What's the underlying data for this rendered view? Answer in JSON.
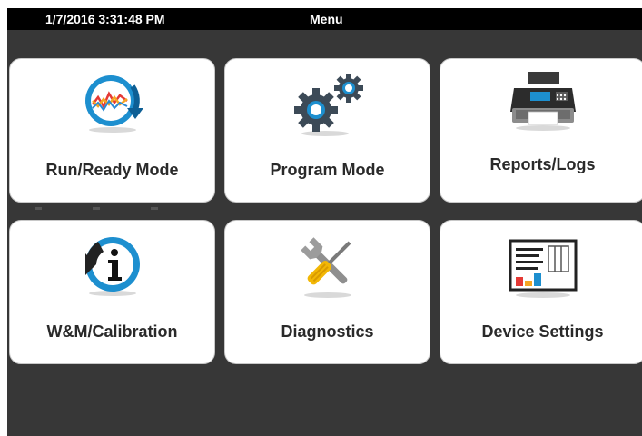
{
  "header": {
    "datetime": "1/7/2016 3:31:48 PM",
    "title": "Menu"
  },
  "tiles": [
    {
      "label": "Run/Ready Mode",
      "icon": "run-ready-chart-icon"
    },
    {
      "label": "Program Mode",
      "icon": "gears-icon"
    },
    {
      "label": "Reports/Logs",
      "icon": "printer-icon"
    },
    {
      "label": "W&M/Calibration",
      "icon": "info-icon"
    },
    {
      "label": "Diagnostics",
      "icon": "tools-icon"
    },
    {
      "label": "Device Settings",
      "icon": "device-settings-icon"
    }
  ],
  "colors": {
    "background": "#373737",
    "titlebar": "#000000",
    "tile": "#ffffff",
    "accent_blue": "#1d8fcf"
  }
}
